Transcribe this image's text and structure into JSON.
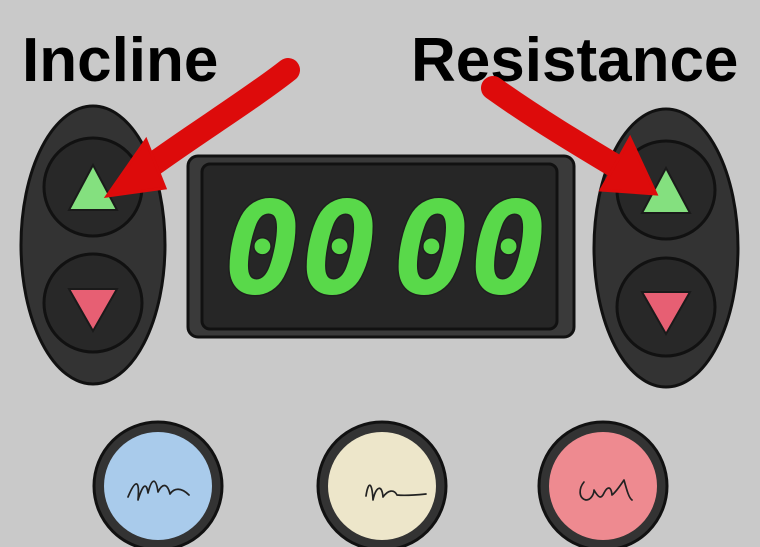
{
  "labels": {
    "left": "Incline",
    "right": "Resistance"
  },
  "display": {
    "value_left": "00",
    "value_right": "00",
    "digit_color": "#59d94a"
  },
  "colors": {
    "arrow": "#dd0b0b",
    "up_triangle": "#84e07f",
    "down_triangle": "#e75f73",
    "round_buttons": [
      "#a9cbeb",
      "#ede6ca",
      "#ee8a90"
    ]
  },
  "icons": {
    "up": "triangle-up-icon",
    "down": "triangle-down-icon",
    "pointer": "red-arrow-icon"
  }
}
